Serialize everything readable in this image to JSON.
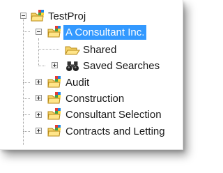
{
  "tree": {
    "root": {
      "label": "TestProj",
      "icon": "project-folder-icon",
      "expanded": true
    },
    "project": {
      "label": "A Consultant Inc.",
      "icon": "project-folder-icon",
      "expanded": true,
      "selected": true
    },
    "children": [
      {
        "label": "Shared",
        "icon": "folder-icon"
      },
      {
        "label": "Saved Searches",
        "icon": "binoculars-icon",
        "collapsed": true
      }
    ],
    "siblings": [
      {
        "label": "Audit",
        "icon": "project-folder-icon",
        "collapsed": true
      },
      {
        "label": "Construction",
        "icon": "project-folder-icon",
        "collapsed": true
      },
      {
        "label": "Consultant Selection",
        "icon": "project-folder-icon",
        "collapsed": true
      },
      {
        "label": "Contracts and Letting",
        "icon": "project-folder-icon",
        "collapsed": true
      }
    ]
  },
  "colors": {
    "selection": "#3399ff",
    "folder": "#f2c94c",
    "folder_dark": "#c99a1a",
    "puzzle_red": "#e53935",
    "puzzle_green": "#43a047",
    "puzzle_blue": "#1e88e5"
  }
}
